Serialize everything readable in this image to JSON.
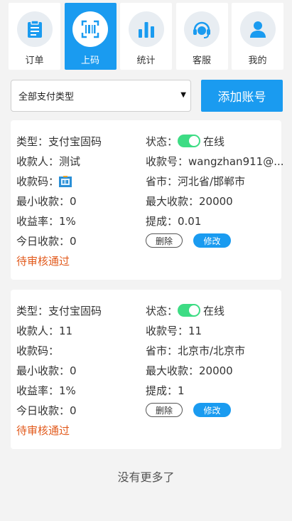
{
  "nav": {
    "items": [
      {
        "label": "订单",
        "icon": "order-list-icon"
      },
      {
        "label": "上码",
        "icon": "barcode-icon",
        "active": true
      },
      {
        "label": "统计",
        "icon": "bar-chart-icon"
      },
      {
        "label": "客服",
        "icon": "headset-icon"
      },
      {
        "label": "我的",
        "icon": "user-icon"
      }
    ]
  },
  "filter": {
    "selected": "全部支付类型",
    "add_label": "添加账号"
  },
  "accounts": [
    {
      "type": "类型：支付宝固码",
      "status_label": "状态：",
      "status_value": "在线",
      "payee": "收款人：测试",
      "account_no": "收款号：wangzhan911@...",
      "qr_label": "收款码：",
      "region": "省市：河北省/邯郸市",
      "min": "最小收款：0",
      "max": "最大收款：20000",
      "rate": "收益率：1%",
      "commission": "提成：0.01",
      "today": "今日收款：0",
      "delete_label": "删除",
      "edit_label": "修改",
      "review": "待审核通过"
    },
    {
      "type": "类型：支付宝固码",
      "status_label": "状态：",
      "status_value": "在线",
      "payee": "收款人：11",
      "account_no": "收款号：11",
      "qr_label": "收款码：",
      "region": "省市：北京市/北京市",
      "min": "最小收款：0",
      "max": "最大收款：20000",
      "rate": "收益率：1%",
      "commission": "提成：1",
      "today": "今日收款：0",
      "delete_label": "删除",
      "edit_label": "修改",
      "review": "待审核通过"
    }
  ],
  "footer": {
    "no_more": "没有更多了"
  },
  "colors": {
    "accent": "#1a9bf0",
    "online_toggle": "#3ddc84",
    "pending": "#e25a1c"
  }
}
